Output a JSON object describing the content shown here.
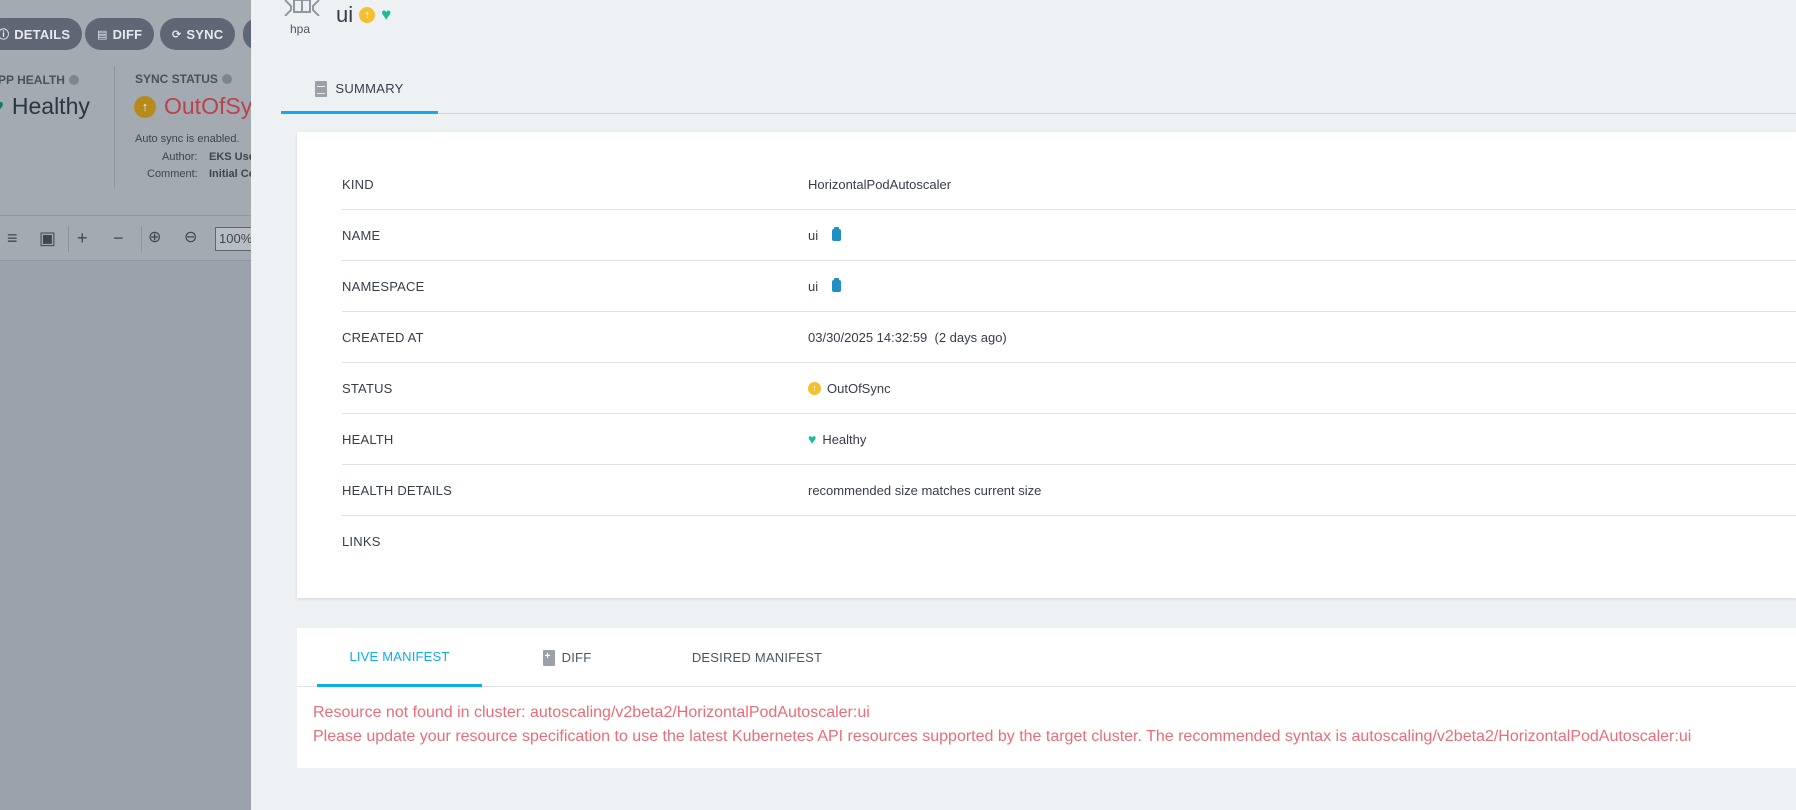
{
  "background_app": {
    "buttons": [
      {
        "icon": "info-icon",
        "label": "DETAILS"
      },
      {
        "icon": "file-diff-icon",
        "label": "DIFF"
      },
      {
        "icon": "sync-icon",
        "label": "SYNC"
      }
    ],
    "app_health_label": "PP HEALTH",
    "app_health_value": "Healthy",
    "sync_status_label": "SYNC STATUS",
    "sync_status_value": "OutOfSyn",
    "auto_sync_text": "Auto sync is enabled.",
    "author_label": "Author:",
    "author_value": "EKS Use",
    "comment_label": "Comment:",
    "comment_value": "Initial Co",
    "zoom": "100%"
  },
  "panel": {
    "kind_short": "hpa",
    "title": "ui",
    "tab_summary": "SUMMARY",
    "summary_rows": [
      {
        "key": "KIND",
        "value": "HorizontalPodAutoscaler"
      },
      {
        "key": "NAME",
        "value": "ui"
      },
      {
        "key": "NAMESPACE",
        "value": "ui"
      },
      {
        "key": "CREATED AT",
        "value": "03/30/2025 14:32:59  (2 days ago)"
      },
      {
        "key": "STATUS",
        "value": "OutOfSync"
      },
      {
        "key": "HEALTH",
        "value": "Healthy"
      },
      {
        "key": "HEALTH DETAILS",
        "value": "recommended size matches current size"
      },
      {
        "key": "LINKS",
        "value": ""
      }
    ],
    "manifest_tabs": {
      "live": "LIVE MANIFEST",
      "diff": "DIFF",
      "desired": "DESIRED MANIFEST"
    },
    "error_line_1": "Resource not found in cluster: autoscaling/v2beta2/HorizontalPodAutoscaler:ui",
    "error_line_2": "Please update your resource specification to use the latest Kubernetes API resources supported by the target cluster. The recommended syntax is autoscaling/v2beta2/HorizontalPodAutoscaler:ui"
  },
  "colors": {
    "accent": "#0dadea",
    "healthy": "#18be94",
    "out_of_sync": "#f4c030",
    "error_text": "#e96d76"
  }
}
